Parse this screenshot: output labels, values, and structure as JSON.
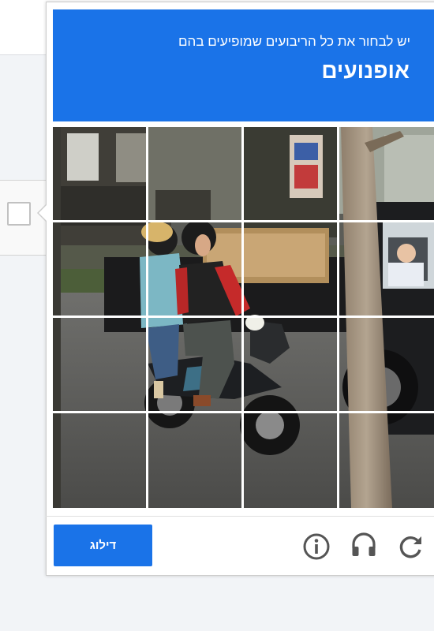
{
  "challenge": {
    "instruction": "יש לבחור את כל הריבועים שמופיעים בהם",
    "target": "אופנועים",
    "header_color": "#1a73e8",
    "grid": {
      "rows": 4,
      "columns": 4
    }
  },
  "footer": {
    "skip_label": "דילוג",
    "icons": [
      "reload-icon",
      "audio-icon",
      "info-icon"
    ]
  }
}
